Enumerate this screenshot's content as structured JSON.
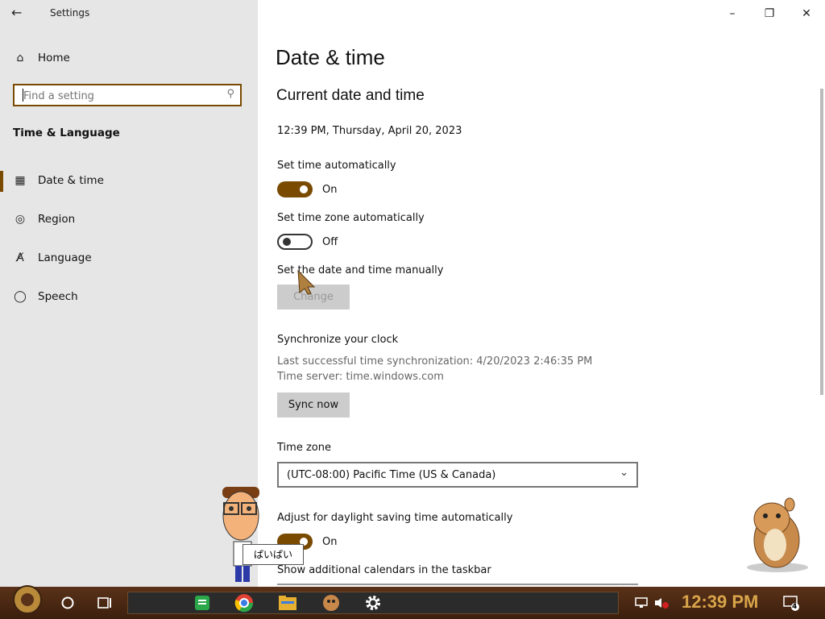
{
  "app": {
    "title": "Settings"
  },
  "sidebar": {
    "home_label": "Home",
    "search_placeholder": "Find a setting",
    "section_label": "Time & Language",
    "items": [
      {
        "label": "Date & time",
        "icon": "calendar-clock-icon",
        "active": true
      },
      {
        "label": "Region",
        "icon": "globe-icon"
      },
      {
        "label": "Language",
        "icon": "language-icon"
      },
      {
        "label": "Speech",
        "icon": "microphone-icon"
      }
    ]
  },
  "main": {
    "page_title": "Date & time",
    "section_title": "Current date and time",
    "current_datetime": "12:39 PM, Thursday, April 20, 2023",
    "set_time_auto": {
      "label": "Set time automatically",
      "state": "On"
    },
    "set_timezone_auto": {
      "label": "Set time zone automatically",
      "state": "Off"
    },
    "manual": {
      "label": "Set the date and time manually",
      "button": "Change"
    },
    "sync": {
      "title": "Synchronize your clock",
      "last_sync": "Last successful time synchronization: 4/20/2023 2:46:35 PM",
      "server": "Time server: time.windows.com",
      "button": "Sync now"
    },
    "timezone": {
      "label": "Time zone",
      "value": "(UTC-08:00) Pacific Time (US & Canada)"
    },
    "daylight": {
      "label": "Adjust for daylight saving time automatically",
      "state": "On"
    },
    "calendars": {
      "label": "Show additional calendars in the taskbar"
    }
  },
  "overlay": {
    "bubble_text": "ぱいぱい"
  },
  "taskbar": {
    "clock": "12:39 PM",
    "notification_count": "4"
  },
  "colors": {
    "accent": "#7a4a00",
    "sidebar_bg": "#e6e6e6",
    "taskbar": "#4a2814",
    "clock": "#d9a44a"
  }
}
